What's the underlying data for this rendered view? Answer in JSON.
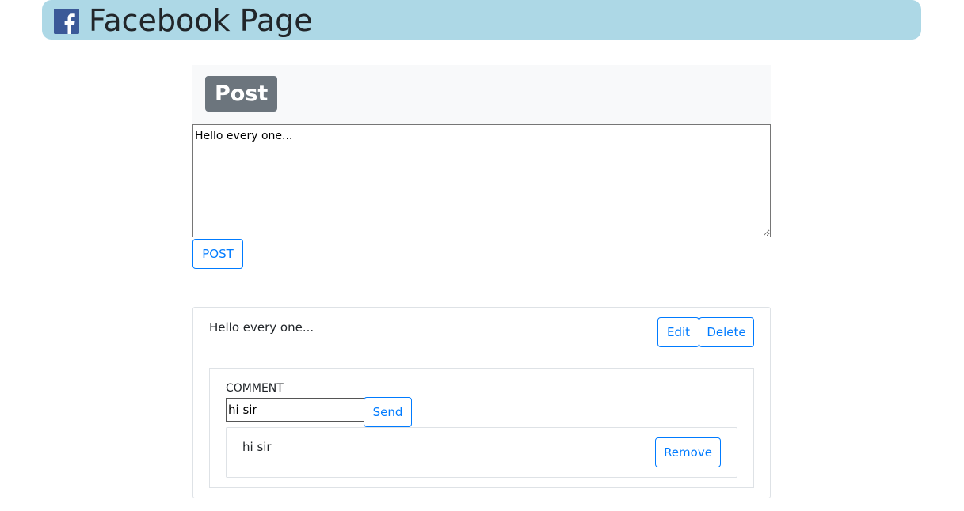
{
  "header": {
    "title": "Facebook Page",
    "icon": "facebook-logo-icon",
    "background": "#add8e6"
  },
  "composer": {
    "badge": "Post",
    "textarea_value": "Hello every one...",
    "post_button": "POST"
  },
  "post": {
    "text": "Hello every one...",
    "edit_button": "Edit",
    "delete_button": "Delete",
    "comments": {
      "label": "COMMENT",
      "input_value": "hi sir",
      "send_button": "Send",
      "items": [
        {
          "text": "hi sir",
          "remove_button": "Remove"
        }
      ]
    }
  },
  "colors": {
    "accent": "#007bff",
    "badge": "#6c757d",
    "panel": "#f8f9fa",
    "border": "#dee2e6"
  }
}
